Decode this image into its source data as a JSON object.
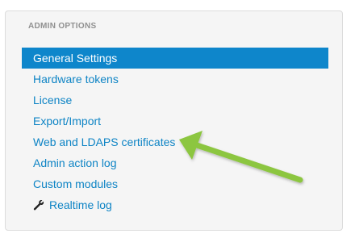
{
  "section": {
    "header": "ADMIN OPTIONS"
  },
  "menu": {
    "items": [
      {
        "label": "General Settings",
        "active": true
      },
      {
        "label": "Hardware tokens"
      },
      {
        "label": "License"
      },
      {
        "label": "Export/Import"
      },
      {
        "label": "Web and LDAPS certificates"
      },
      {
        "label": "Admin action log"
      },
      {
        "label": "Custom modules"
      },
      {
        "label": "Realtime log",
        "icon": "wrench-icon"
      }
    ]
  },
  "colors": {
    "active_background": "#0e86cb",
    "link": "#0e84c5",
    "panel_background": "#f5f5f5",
    "annotation_arrow": "#8cc63f"
  }
}
